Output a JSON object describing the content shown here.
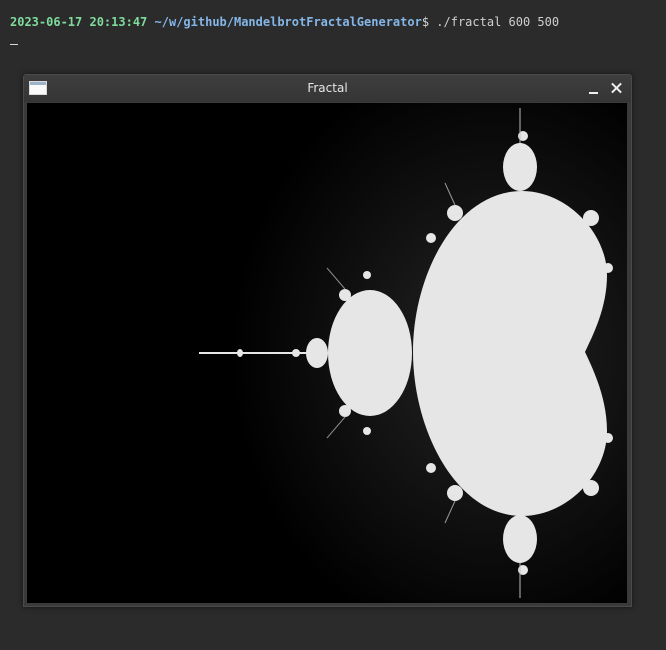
{
  "terminal": {
    "timestamp": "2023-06-17 20:13:47",
    "cwd": "~/w/github/MandelbrotFractalGenerator",
    "prompt_symbol": "$",
    "command": " ./fractal 600 500"
  },
  "window": {
    "title": "Fractal",
    "minimize_icon": "minimize-icon",
    "close_icon": "close-icon",
    "app_icon": "window-icon"
  },
  "colors": {
    "timestamp": "#7fdc9c",
    "path": "#84b6e8",
    "terminal_bg": "#2b2b2b",
    "set_fill": "#e6e6e6",
    "canvas_bg": "#000000"
  }
}
